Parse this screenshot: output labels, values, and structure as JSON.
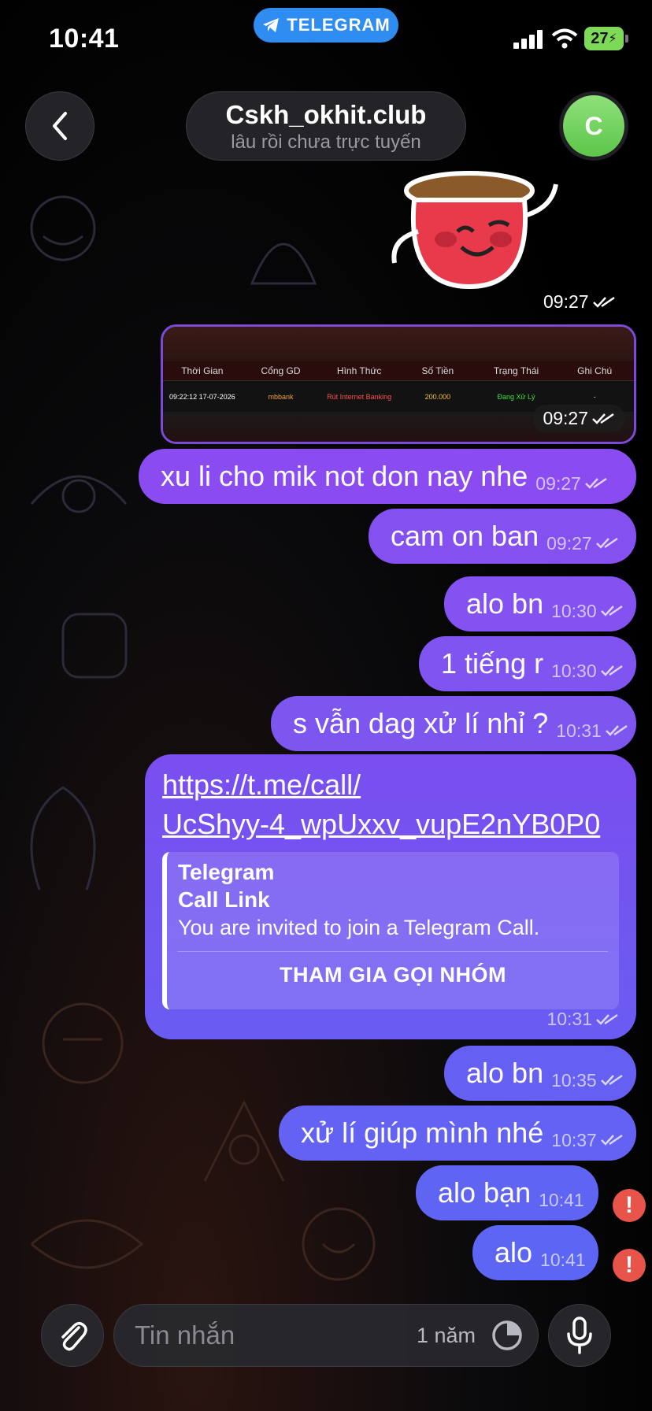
{
  "status_bar": {
    "time": "10:41",
    "app_pill": "TELEGRAM",
    "battery": "27"
  },
  "header": {
    "title": "Cskh_okhit.club",
    "subtitle": "lâu rồi chưa trực tuyến",
    "avatar_letter": "C"
  },
  "messages": {
    "sticker_time": "09:27",
    "screenshot": {
      "time": "09:27",
      "columns": [
        "Thời Gian",
        "Cổng GD",
        "Hình Thức",
        "Số Tiền",
        "Trạng Thái",
        "Ghi Chú"
      ],
      "row": [
        "09:22:12 17-07-2026",
        "mbbank",
        "Rút Internet Banking",
        "200.000",
        "Đang Xử Lý",
        "-"
      ]
    },
    "m1": {
      "text": "xu li cho mik not don nay nhe",
      "time": "09:27"
    },
    "m2": {
      "text": "cam on ban",
      "time": "09:27"
    },
    "m3": {
      "text": "alo bn",
      "time": "10:30"
    },
    "m4": {
      "text": "1 tiếng r",
      "time": "10:30"
    },
    "m5": {
      "text": "s vẫn dag xử lí nhỉ ?",
      "time": "10:31"
    },
    "link": {
      "line1": "https://t.me/call/",
      "line2": "UcShyy-4_wpUxxv_vupE2nYB0P0",
      "preview_site": "Telegram",
      "preview_title": "Call Link",
      "preview_desc": "You are invited to join a Telegram Call.",
      "preview_action": "THAM GIA GỌI NHÓM",
      "time": "10:31"
    },
    "m6": {
      "text": "alo bn",
      "time": "10:35"
    },
    "m7": {
      "text": "xử lí giúp mình nhé",
      "time": "10:37"
    },
    "m8": {
      "text": "alo bạn",
      "time": "10:41"
    },
    "m9": {
      "text": "alo",
      "time": "10:41"
    }
  },
  "input_bar": {
    "placeholder": "Tin nhắn",
    "timer_label": "1 năm"
  },
  "colors": {
    "bubble_top": "#8a4cf0",
    "bubble_bottom": "#5b64f0",
    "error": "#e8544a",
    "accent": "#2f8cf0"
  }
}
